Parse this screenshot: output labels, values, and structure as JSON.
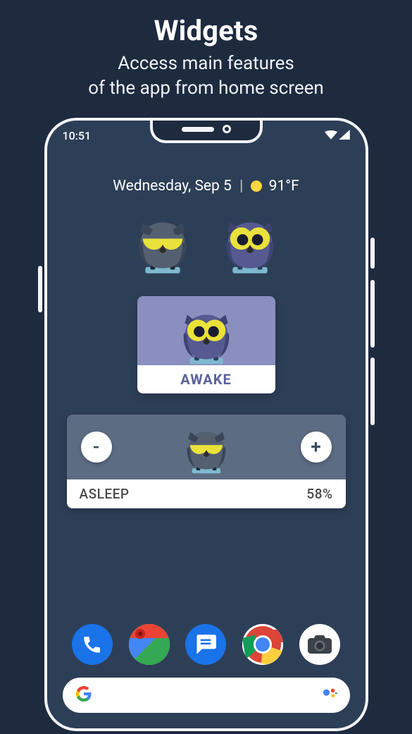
{
  "promo": {
    "title": "Widgets",
    "line1": "Access main features",
    "line2": "of the app from home screen"
  },
  "status": {
    "time": "10:51"
  },
  "home": {
    "date": "Wednesday, Sep 5",
    "temp": "91°F"
  },
  "toggle_widgets": [
    {
      "name": "owl-asleep-toggle",
      "state": "asleep"
    },
    {
      "name": "owl-awake-toggle",
      "state": "awake"
    }
  ],
  "awake_card": {
    "label": "AWAKE"
  },
  "asleep_card": {
    "minus": "-",
    "plus": "+",
    "label": "ASLEEP",
    "percent": "58%"
  },
  "dock": {
    "phone": "phone-app",
    "maps": "maps-app",
    "messages": "messages-app",
    "chrome": "chrome-app",
    "camera": "camera-app"
  },
  "search": {
    "logo": "G",
    "assistant": "assistant-icon"
  }
}
